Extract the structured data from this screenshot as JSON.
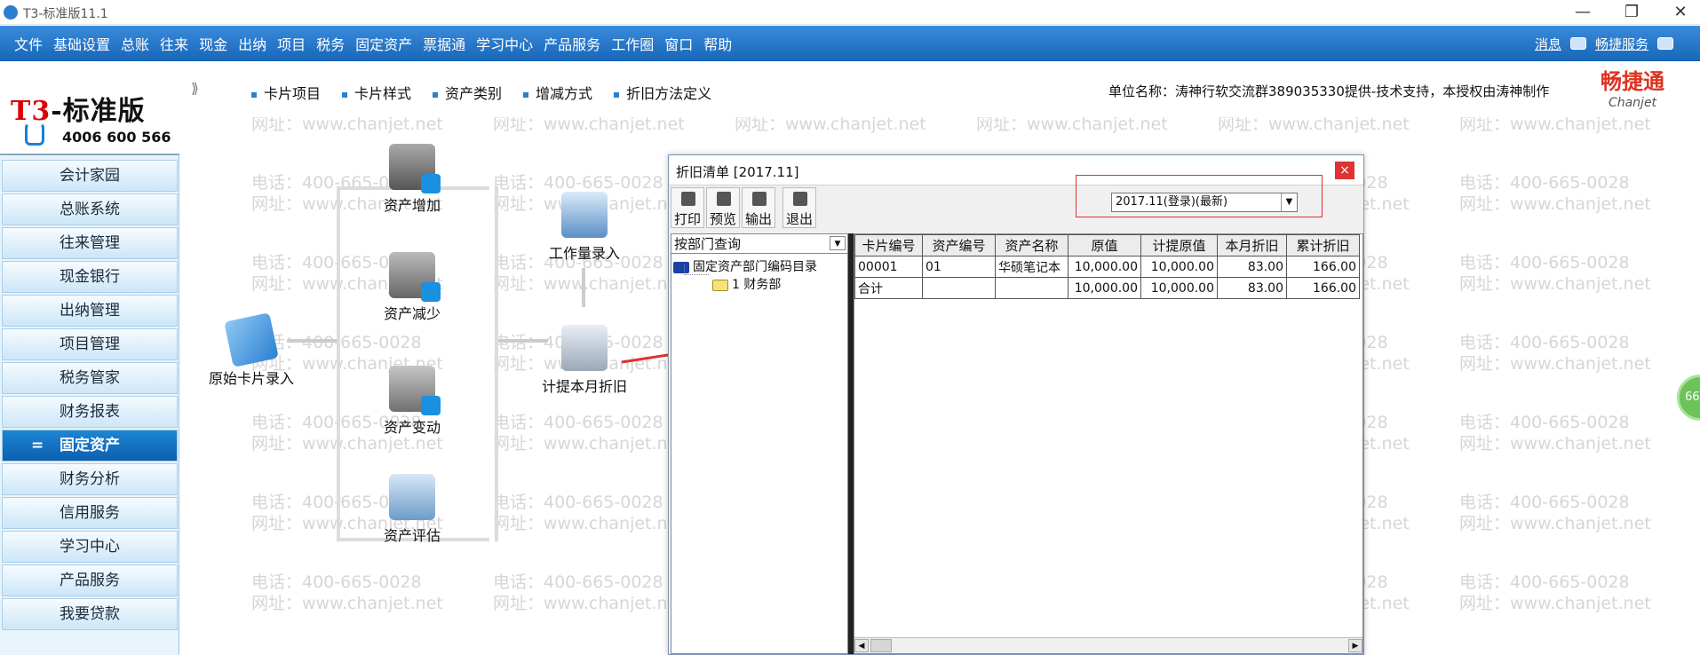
{
  "window": {
    "title": "T3-标准版11.1",
    "minimize": "—",
    "restore": "❐",
    "close": "✕"
  },
  "menubar": {
    "items": [
      "文件",
      "基础设置",
      "总账",
      "往来",
      "现金",
      "出纳",
      "项目",
      "税务",
      "固定资产",
      "票据通",
      "学习中心",
      "产品服务",
      "工作圈",
      "窗口",
      "帮助"
    ],
    "right": {
      "message": "消息",
      "service": "畅捷服务"
    }
  },
  "logo": {
    "brand_prefix": "T3",
    "brand_suffix": "-标准版",
    "phone": "4006 600 566"
  },
  "sidebar": {
    "items": [
      "会计家园",
      "总账系统",
      "往来管理",
      "现金银行",
      "出纳管理",
      "项目管理",
      "税务管家",
      "财务报表",
      "固定资产",
      "财务分析",
      "信用服务",
      "学习中心",
      "产品服务",
      "我要贷款"
    ],
    "active_index": 8,
    "active_marker": "="
  },
  "subheader": {
    "expand_icon": "⟫",
    "links": [
      "卡片项目",
      "卡片样式",
      "资产类别",
      "增减方式",
      "折旧方法定义"
    ],
    "unit": "单位名称：涛神行软交流群389035330提供-技术支持，本授权由涛神制作",
    "brand_cn": "畅捷通",
    "brand_en": "Chanjet"
  },
  "watermark": {
    "phone": "电话：400-665-0028",
    "web": "网址：www.chanjet.net"
  },
  "flow": {
    "original_card": "原始卡片录入",
    "asset_add": "资产增加",
    "asset_reduce": "资产减少",
    "asset_change": "资产变动",
    "asset_eval": "资产评估",
    "work_entry": "工作量录入",
    "monthly_dep": "计提本月折旧"
  },
  "dialog": {
    "title": "折旧清单 [2017.11]",
    "close": "×",
    "toolbar": {
      "print": "打印",
      "preview": "预览",
      "export": "输出",
      "exit": "退出"
    },
    "period_select": "2017.11(登录)(最新)",
    "query_select": "按部门查询",
    "tree": {
      "root": "固定资产部门编码目录",
      "child": "1 财务部"
    },
    "table": {
      "headers": [
        "卡片编号",
        "资产编号",
        "资产名称",
        "原值",
        "计提原值",
        "本月折旧",
        "累计折旧"
      ],
      "rows": [
        [
          "00001",
          "01",
          "华硕笔记本",
          "10,000.00",
          "10,000.00",
          "83.00",
          "166.00"
        ],
        [
          "合计",
          "",
          "",
          "10,000.00",
          "10,000.00",
          "83.00",
          "166.00"
        ]
      ]
    },
    "scroll_left": "◀",
    "scroll_right": "▶"
  },
  "side_badge": "66",
  "colors": {
    "accent": "#1766b8",
    "highlight": "#d33"
  }
}
